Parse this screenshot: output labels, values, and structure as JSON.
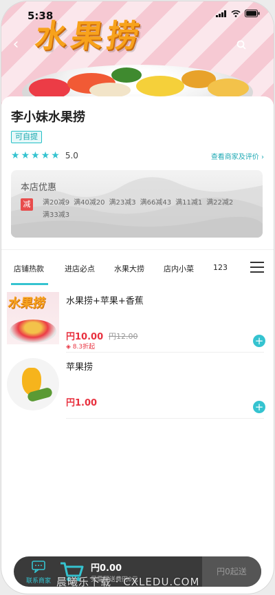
{
  "status_bar": {
    "time": "5:38"
  },
  "banner": {
    "title": "水果捞"
  },
  "store": {
    "name": "李小妹水果捞",
    "pickup_badge": "可自提",
    "rating": "5.0",
    "merchant_link": "查看商家及评价",
    "offers": {
      "title": "本店优惠",
      "tag": "减",
      "items": [
        "满20减9",
        "满40减20",
        "满23减3",
        "满66减43",
        "满11减1",
        "满22减2",
        "满33减3"
      ]
    }
  },
  "tabs": [
    "店铺热款",
    "进店必点",
    "水果大捞",
    "店内小菜",
    "123"
  ],
  "products": [
    {
      "name": "水果捞+苹果+香蕉",
      "price": "円10.00",
      "old_price": "円12.00",
      "sales": "8.3折起",
      "thumb_title": "水果捞"
    },
    {
      "name": "苹果捞",
      "price": "円1.00"
    }
  ],
  "cart": {
    "contact_label": "联系商家",
    "total": "円0.00",
    "delivery_fee": "另需配送费円0元",
    "checkout": "円0起送"
  },
  "watermark": "晨曦乐下载 · CXLEDU.COM",
  "colors": {
    "accent": "#35c3d0",
    "price_red": "#e8313f",
    "banner_orange": "#f7a21c"
  }
}
